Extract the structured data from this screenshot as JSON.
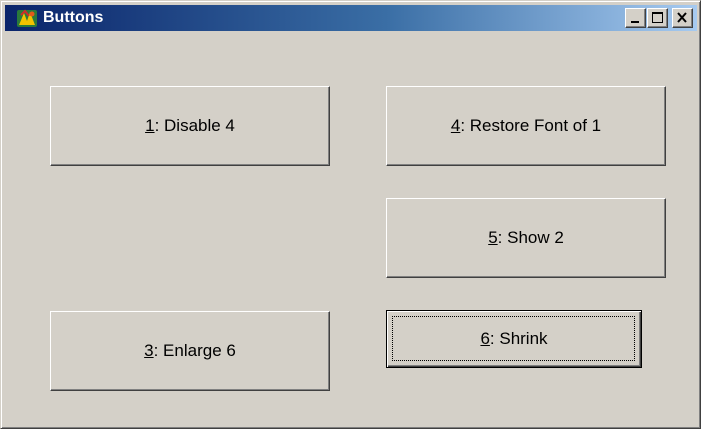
{
  "window": {
    "title": "Buttons",
    "app_icon": "app-icon",
    "controls": [
      "minimize-icon",
      "maximize-icon",
      "close-icon"
    ]
  },
  "buttons": {
    "b1": {
      "key": "1",
      "rest": ": Disable 4"
    },
    "b3": {
      "key": "3",
      "rest": ": Enlarge 6"
    },
    "b4": {
      "key": "4",
      "rest": ": Restore Font of 1"
    },
    "b5": {
      "key": "5",
      "rest": ": Show 2"
    },
    "b6": {
      "key": "6",
      "rest": ": Shrink"
    }
  },
  "focused_button": "b6",
  "colors": {
    "face": "#d4d0c8",
    "title_start": "#0a246a",
    "title_end": "#a6caf0"
  }
}
